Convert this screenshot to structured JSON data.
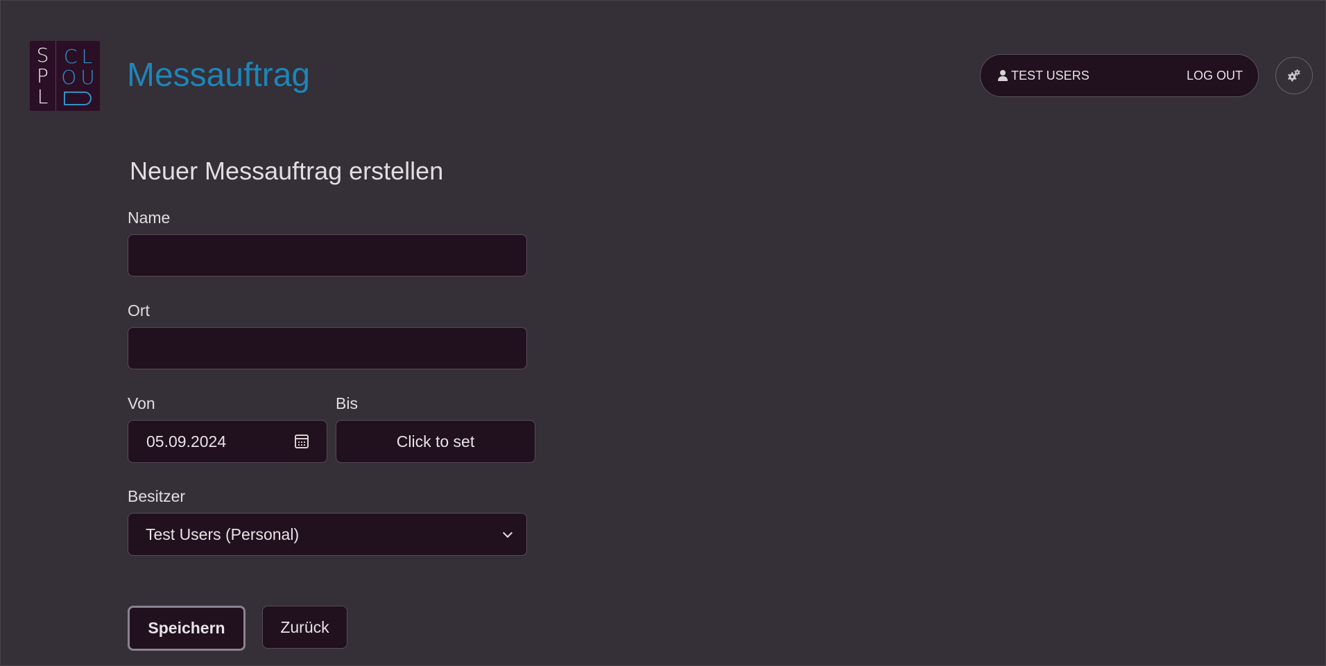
{
  "logo": {
    "left_letters": [
      "S",
      "P",
      "L"
    ],
    "right_rows": [
      [
        "C",
        "L"
      ],
      [
        "O",
        "U"
      ]
    ]
  },
  "header": {
    "title": "Messauftrag",
    "user_name": "TEST USERS",
    "logout_label": "LOG OUT",
    "settings_icon": "gears-icon"
  },
  "form": {
    "title": "Neuer Messauftrag erstellen",
    "name": {
      "label": "Name",
      "value": "",
      "placeholder": ""
    },
    "ort": {
      "label": "Ort",
      "value": "",
      "placeholder": ""
    },
    "von": {
      "label": "Von",
      "value": "05.09.2024"
    },
    "bis": {
      "label": "Bis",
      "value": "Click to set"
    },
    "besitzer": {
      "label": "Besitzer",
      "selected": "Test Users (Personal)"
    },
    "save_label": "Speichern",
    "back_label": "Zurück"
  },
  "colors": {
    "background": "#352f37",
    "input_background": "#21101d",
    "accent": "#1e85b8"
  }
}
